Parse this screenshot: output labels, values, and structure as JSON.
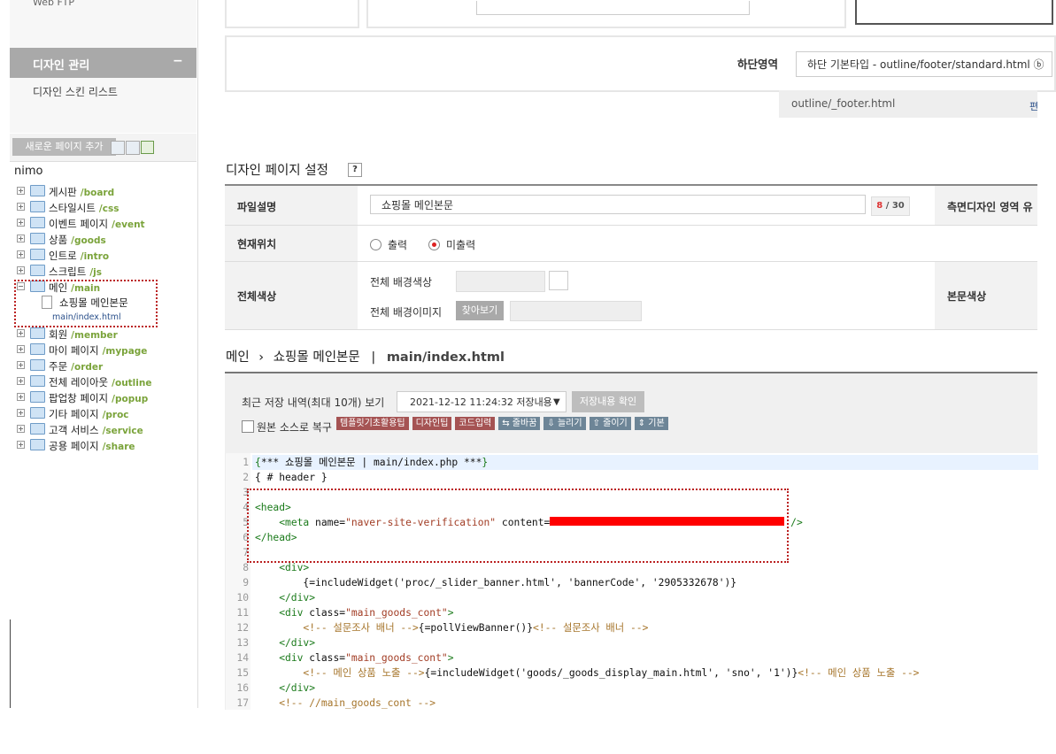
{
  "sidebar": {
    "top_cut_label": "Web FTP",
    "design_menu": {
      "title": "디자인 관리",
      "toggle": "−",
      "items": [
        "디자인 스킨 리스트"
      ]
    },
    "add_page_button": "새로운 페이지 추가",
    "tree_root": "nimo",
    "tree": [
      {
        "name": "게시판",
        "path": "/board"
      },
      {
        "name": "스타일시트",
        "path": "/css"
      },
      {
        "name": "이벤트 페이지",
        "path": "/event"
      },
      {
        "name": "상품",
        "path": "/goods"
      },
      {
        "name": "인트로",
        "path": "/intro"
      },
      {
        "name": "스크립트",
        "path": "/js"
      },
      {
        "name": "메인",
        "path": "/main"
      },
      {
        "name": "회원",
        "path": "/member"
      },
      {
        "name": "마이 페이지",
        "path": "/mypage"
      },
      {
        "name": "주문",
        "path": "/order"
      },
      {
        "name": "전체 레이아웃",
        "path": "/outline"
      },
      {
        "name": "팝업창 페이지",
        "path": "/popup"
      },
      {
        "name": "기타 페이지",
        "path": "/proc"
      },
      {
        "name": "고객 서비스",
        "path": "/service"
      },
      {
        "name": "공용 페이지",
        "path": "/share"
      }
    ],
    "main_child": {
      "name": "쇼핑몰 메인본문",
      "file": "main/index.html"
    }
  },
  "footer_area": {
    "label": "하단영역",
    "select_value": "하단 기본타입 - outline/footer/standard.html ⓑ",
    "file": "outline/_footer.html",
    "edit_link": "편"
  },
  "settings": {
    "title": "디자인 페이지 설정",
    "help": "?",
    "file_desc_label": "파일설명",
    "file_desc_value": "쇼핑몰 메인본문",
    "counter_cur": "8",
    "counter_max": " / 30",
    "side_design_label": "측면디자인 영역 유",
    "location_label": "현재위치",
    "radio_out": "출력",
    "radio_no_out": "미출력",
    "bg_label": "전체색상",
    "bg_color_label": "전체 배경색상",
    "bg_image_label": "전체 배경이미지",
    "find_button": "찾아보기",
    "body_color_label": "본문색상"
  },
  "breadcrumb": {
    "root": "메인",
    "sep": "›",
    "page": "쇼핑몰 메인본문",
    "bar": "|",
    "file": "main/index.html"
  },
  "editor": {
    "history_label": "최근 저장 내역(최대 10개) 보기",
    "history_select": "2021-12-12 11:24:32 저장내용",
    "history_confirm": "저장내용 확인",
    "restore_label": "원본 소스로 복구",
    "tags_red": [
      "템플릿기초활용팁",
      "디자인팁",
      "코드입력"
    ],
    "tags_blue": [
      "⇆ 줄바꿈",
      "⇩ 늘리기",
      "⇧ 줄이기",
      "⇕ 기본"
    ]
  }
}
